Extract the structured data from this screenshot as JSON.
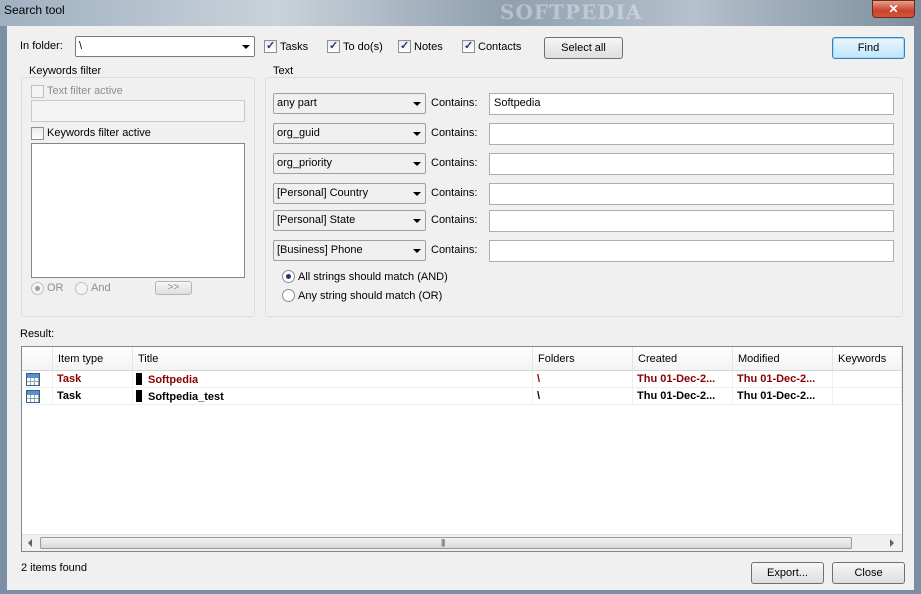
{
  "window": {
    "title": "Search tool",
    "watermark": "SOFTPEDIA",
    "close_glyph": "✕"
  },
  "top": {
    "folder_label": "In folder:",
    "folder_value": "\\",
    "types": [
      {
        "label": "Tasks",
        "checked": true
      },
      {
        "label": "To do(s)",
        "checked": true
      },
      {
        "label": "Notes",
        "checked": true
      },
      {
        "label": "Contacts",
        "checked": true
      }
    ],
    "select_all_label": "Select all",
    "find_label": "Find"
  },
  "keywords": {
    "group_title": "Keywords filter",
    "text_filter_label": "Text filter active",
    "keywords_filter_label": "Keywords filter active",
    "or_label": "OR",
    "and_label": "And",
    "move_label": ">>"
  },
  "text_filter": {
    "group_title": "Text",
    "rows": [
      {
        "field": "any part",
        "contains_label": "Contains:",
        "value": "Softpedia"
      },
      {
        "field": "org_guid",
        "contains_label": "Contains:",
        "value": ""
      },
      {
        "field": "org_priority",
        "contains_label": "Contains:",
        "value": ""
      },
      {
        "field": "[Personal] Country",
        "contains_label": "Contains:",
        "value": ""
      },
      {
        "field": "[Personal] State",
        "contains_label": "Contains:",
        "value": ""
      },
      {
        "field": "[Business] Phone",
        "contains_label": "Contains:",
        "value": ""
      }
    ],
    "match_and_label": "All strings should match (AND)",
    "match_or_label": "Any string should match (OR)"
  },
  "result": {
    "label": "Result:",
    "columns": [
      "",
      "Item type",
      "Title",
      "Folders",
      "Created",
      "Modified",
      "Keywords"
    ],
    "rows": [
      {
        "type": "Task",
        "title": "Softpedia",
        "folder": "\\",
        "created": "Thu 01-Dec-2...",
        "modified": "Thu 01-Dec-2...",
        "keywords": ""
      },
      {
        "type": "Task",
        "title": "Softpedia_test",
        "folder": "\\",
        "created": "Thu 01-Dec-2...",
        "modified": "Thu 01-Dec-2...",
        "keywords": ""
      }
    ],
    "scroll_grip": "|||"
  },
  "footer": {
    "status": "2 items found",
    "export_label": "Export...",
    "close_label": "Close"
  },
  "colors": {
    "accent_red": "#8b0000",
    "find_button": "#bee6fd"
  }
}
